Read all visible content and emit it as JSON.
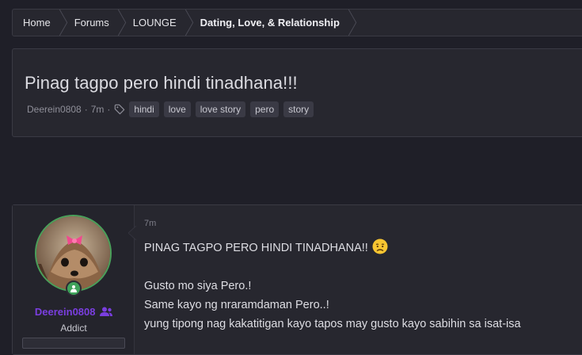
{
  "breadcrumb": {
    "items": [
      {
        "label": "Home"
      },
      {
        "label": "Forums"
      },
      {
        "label": "LOUNGE"
      },
      {
        "label": "Dating, Love, & Relationship"
      }
    ]
  },
  "thread": {
    "title": "Pinag tagpo pero hindi tinadhana!!!",
    "author": "Deerein0808",
    "separator": "·",
    "time": "7m",
    "tags": [
      "hindi",
      "love",
      "love story",
      "pero",
      "story"
    ]
  },
  "post": {
    "user": {
      "name": "Deerein0808",
      "title": "Addict"
    },
    "time": "7m",
    "lines": {
      "l1": "PINAG TAGPO PERO HINDI TINADHANA!!",
      "l2": "Gusto mo siya Pero.!",
      "l3": "Same kayo ng nraramdaman Pero..!",
      "l4": "yung tipong nag kakatitigan kayo tapos may gusto kayo sabihin sa isat-isa"
    }
  },
  "colors": {
    "background": "#1f1f28",
    "panel": "#27272f",
    "username": "#7a3ee0",
    "online": "#3fa35b"
  }
}
